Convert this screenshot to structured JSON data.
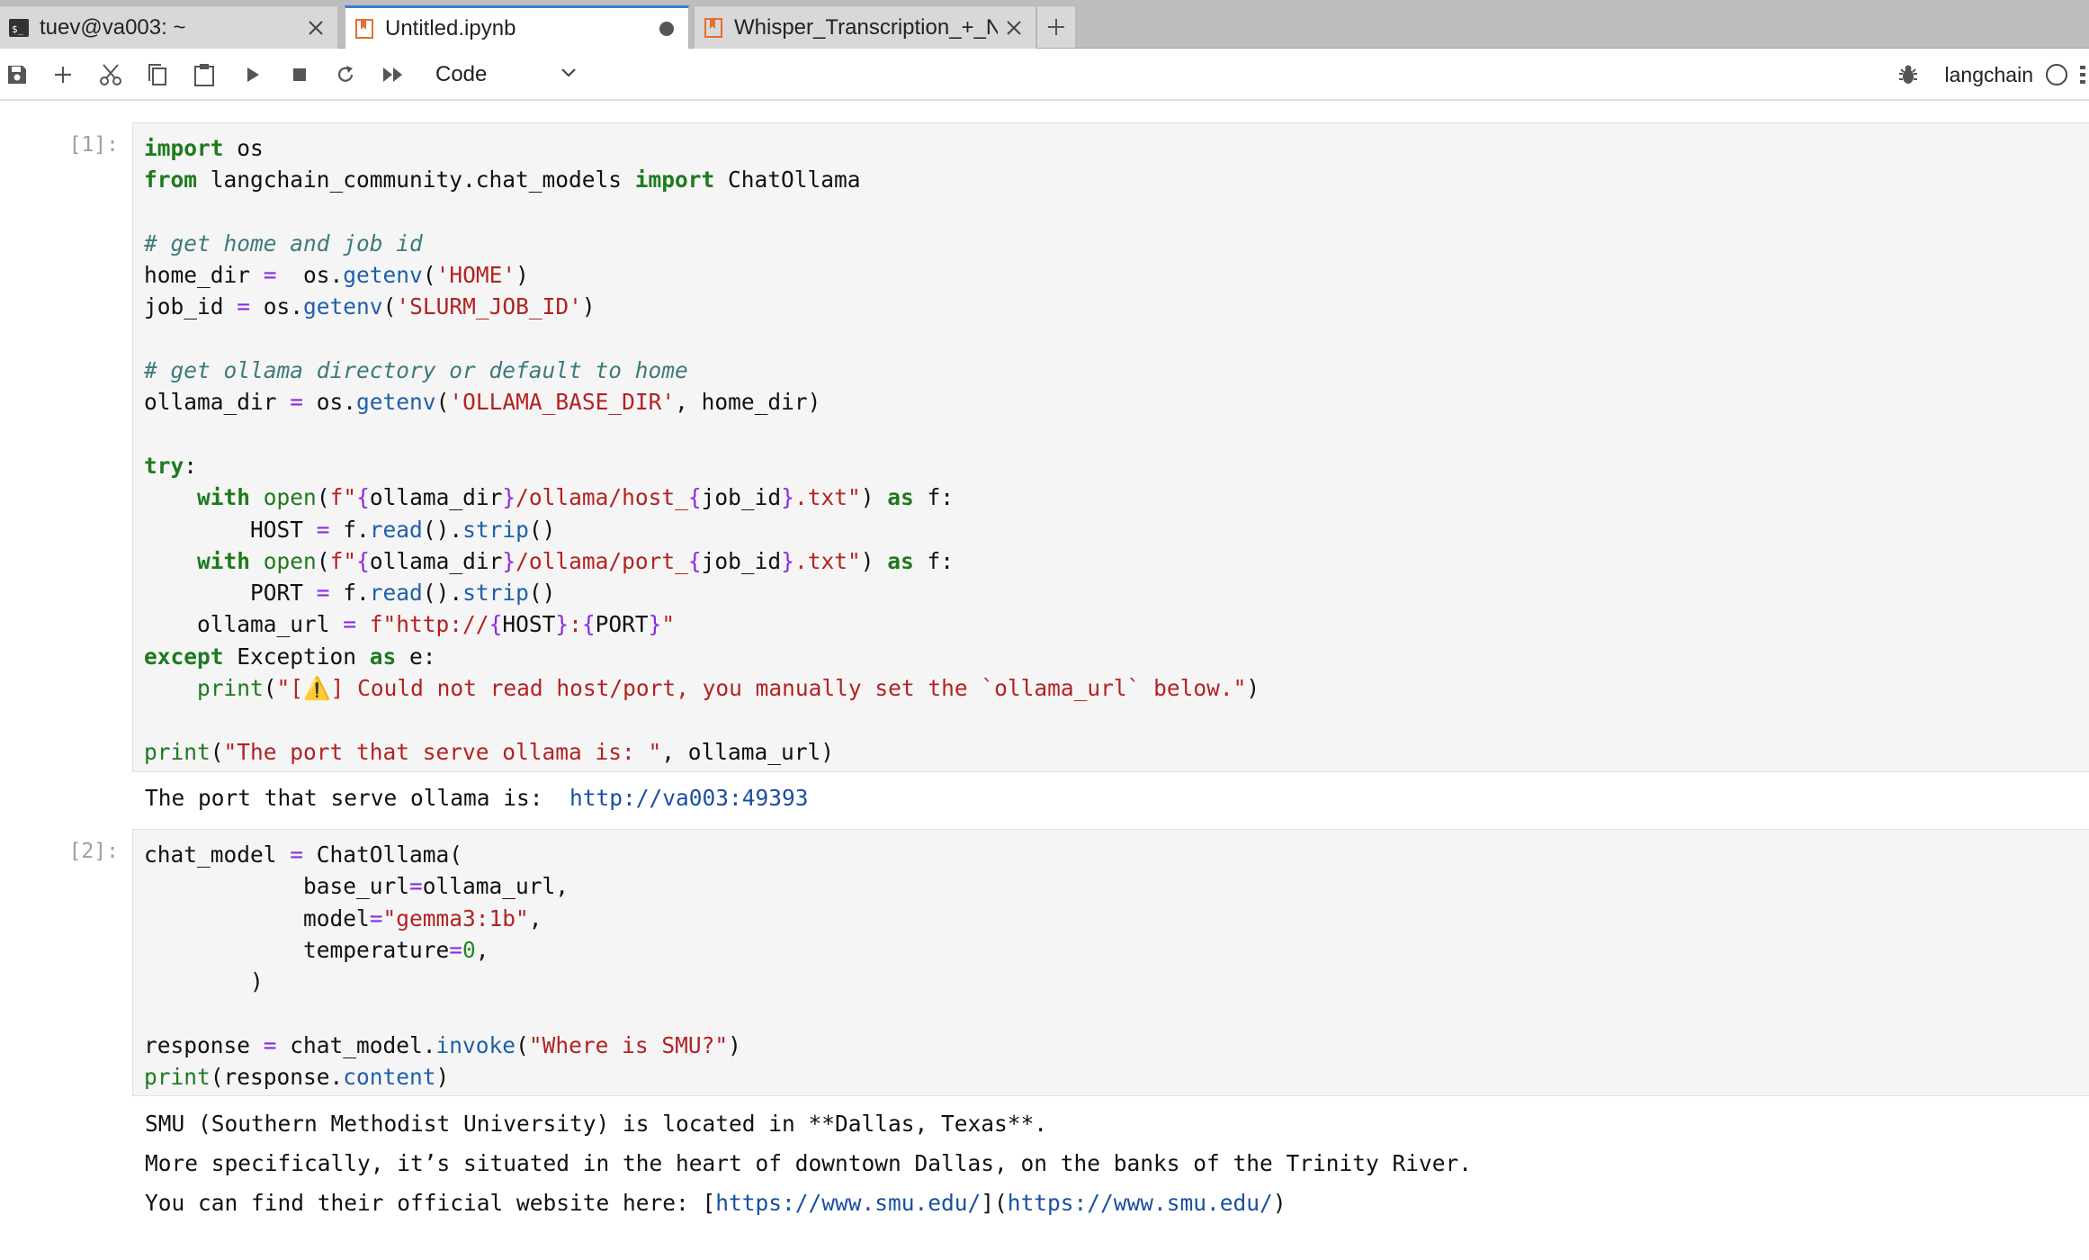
{
  "tabs": [
    {
      "label": "tuev@va003: ~",
      "icon": "terminal-icon",
      "active": false
    },
    {
      "label": "Untitled.ipynb",
      "icon": "notebook-icon",
      "active": true,
      "status": "unsaved-dot"
    },
    {
      "label": "Whisper_Transcription_+_N",
      "icon": "notebook-icon",
      "active": false
    }
  ],
  "toolbar": {
    "buttons": [
      "save-icon",
      "add-icon",
      "cut-icon",
      "copy-icon",
      "paste-icon",
      "run-icon",
      "stop-icon",
      "restart-icon",
      "run-all-icon"
    ],
    "cell_type": "Code",
    "kernel_name": "langchain"
  },
  "cells": [
    {
      "prompt": "[1]:",
      "code_lines": [
        "import os",
        "from langchain_community.chat_models import ChatOllama",
        "",
        "# get home and job id",
        "home_dir =  os.getenv('HOME')",
        "job_id = os.getenv('SLURM_JOB_ID')",
        "",
        "# get ollama directory or default to home",
        "ollama_dir = os.getenv('OLLAMA_BASE_DIR', home_dir)",
        "",
        "try:",
        "    with open(f\"{ollama_dir}/ollama/host_{job_id}.txt\") as f:",
        "        HOST = f.read().strip()",
        "    with open(f\"{ollama_dir}/ollama/port_{job_id}.txt\") as f:",
        "        PORT = f.read().strip()",
        "    ollama_url = f\"http://{HOST}:{PORT}\"",
        "except Exception as e:",
        "    print(\"[⚠️] Could not read host/port, you manually set the `ollama_url` below.\")",
        "",
        "print(\"The port that serve ollama is: \", ollama_url)"
      ],
      "output_lines": [
        "The port that serve ollama is:  http://va003:49393"
      ]
    },
    {
      "prompt": "[2]:",
      "code_lines": [
        "chat_model = ChatOllama(",
        "            base_url=ollama_url,",
        "            model=\"gemma3:1b\",",
        "            temperature=0,",
        "        )",
        "",
        "response = chat_model.invoke(\"Where is SMU?\")",
        "print(response.content)"
      ],
      "output_lines": [
        "SMU (Southern Methodist University) is located in **Dallas, Texas**.",
        "",
        "More specifically, it’s situated in the heart of downtown Dallas, on the banks of the Trinity River.",
        "",
        "You can find their official website here: [https://www.smu.edu/](https://www.smu.edu/)"
      ]
    }
  ]
}
